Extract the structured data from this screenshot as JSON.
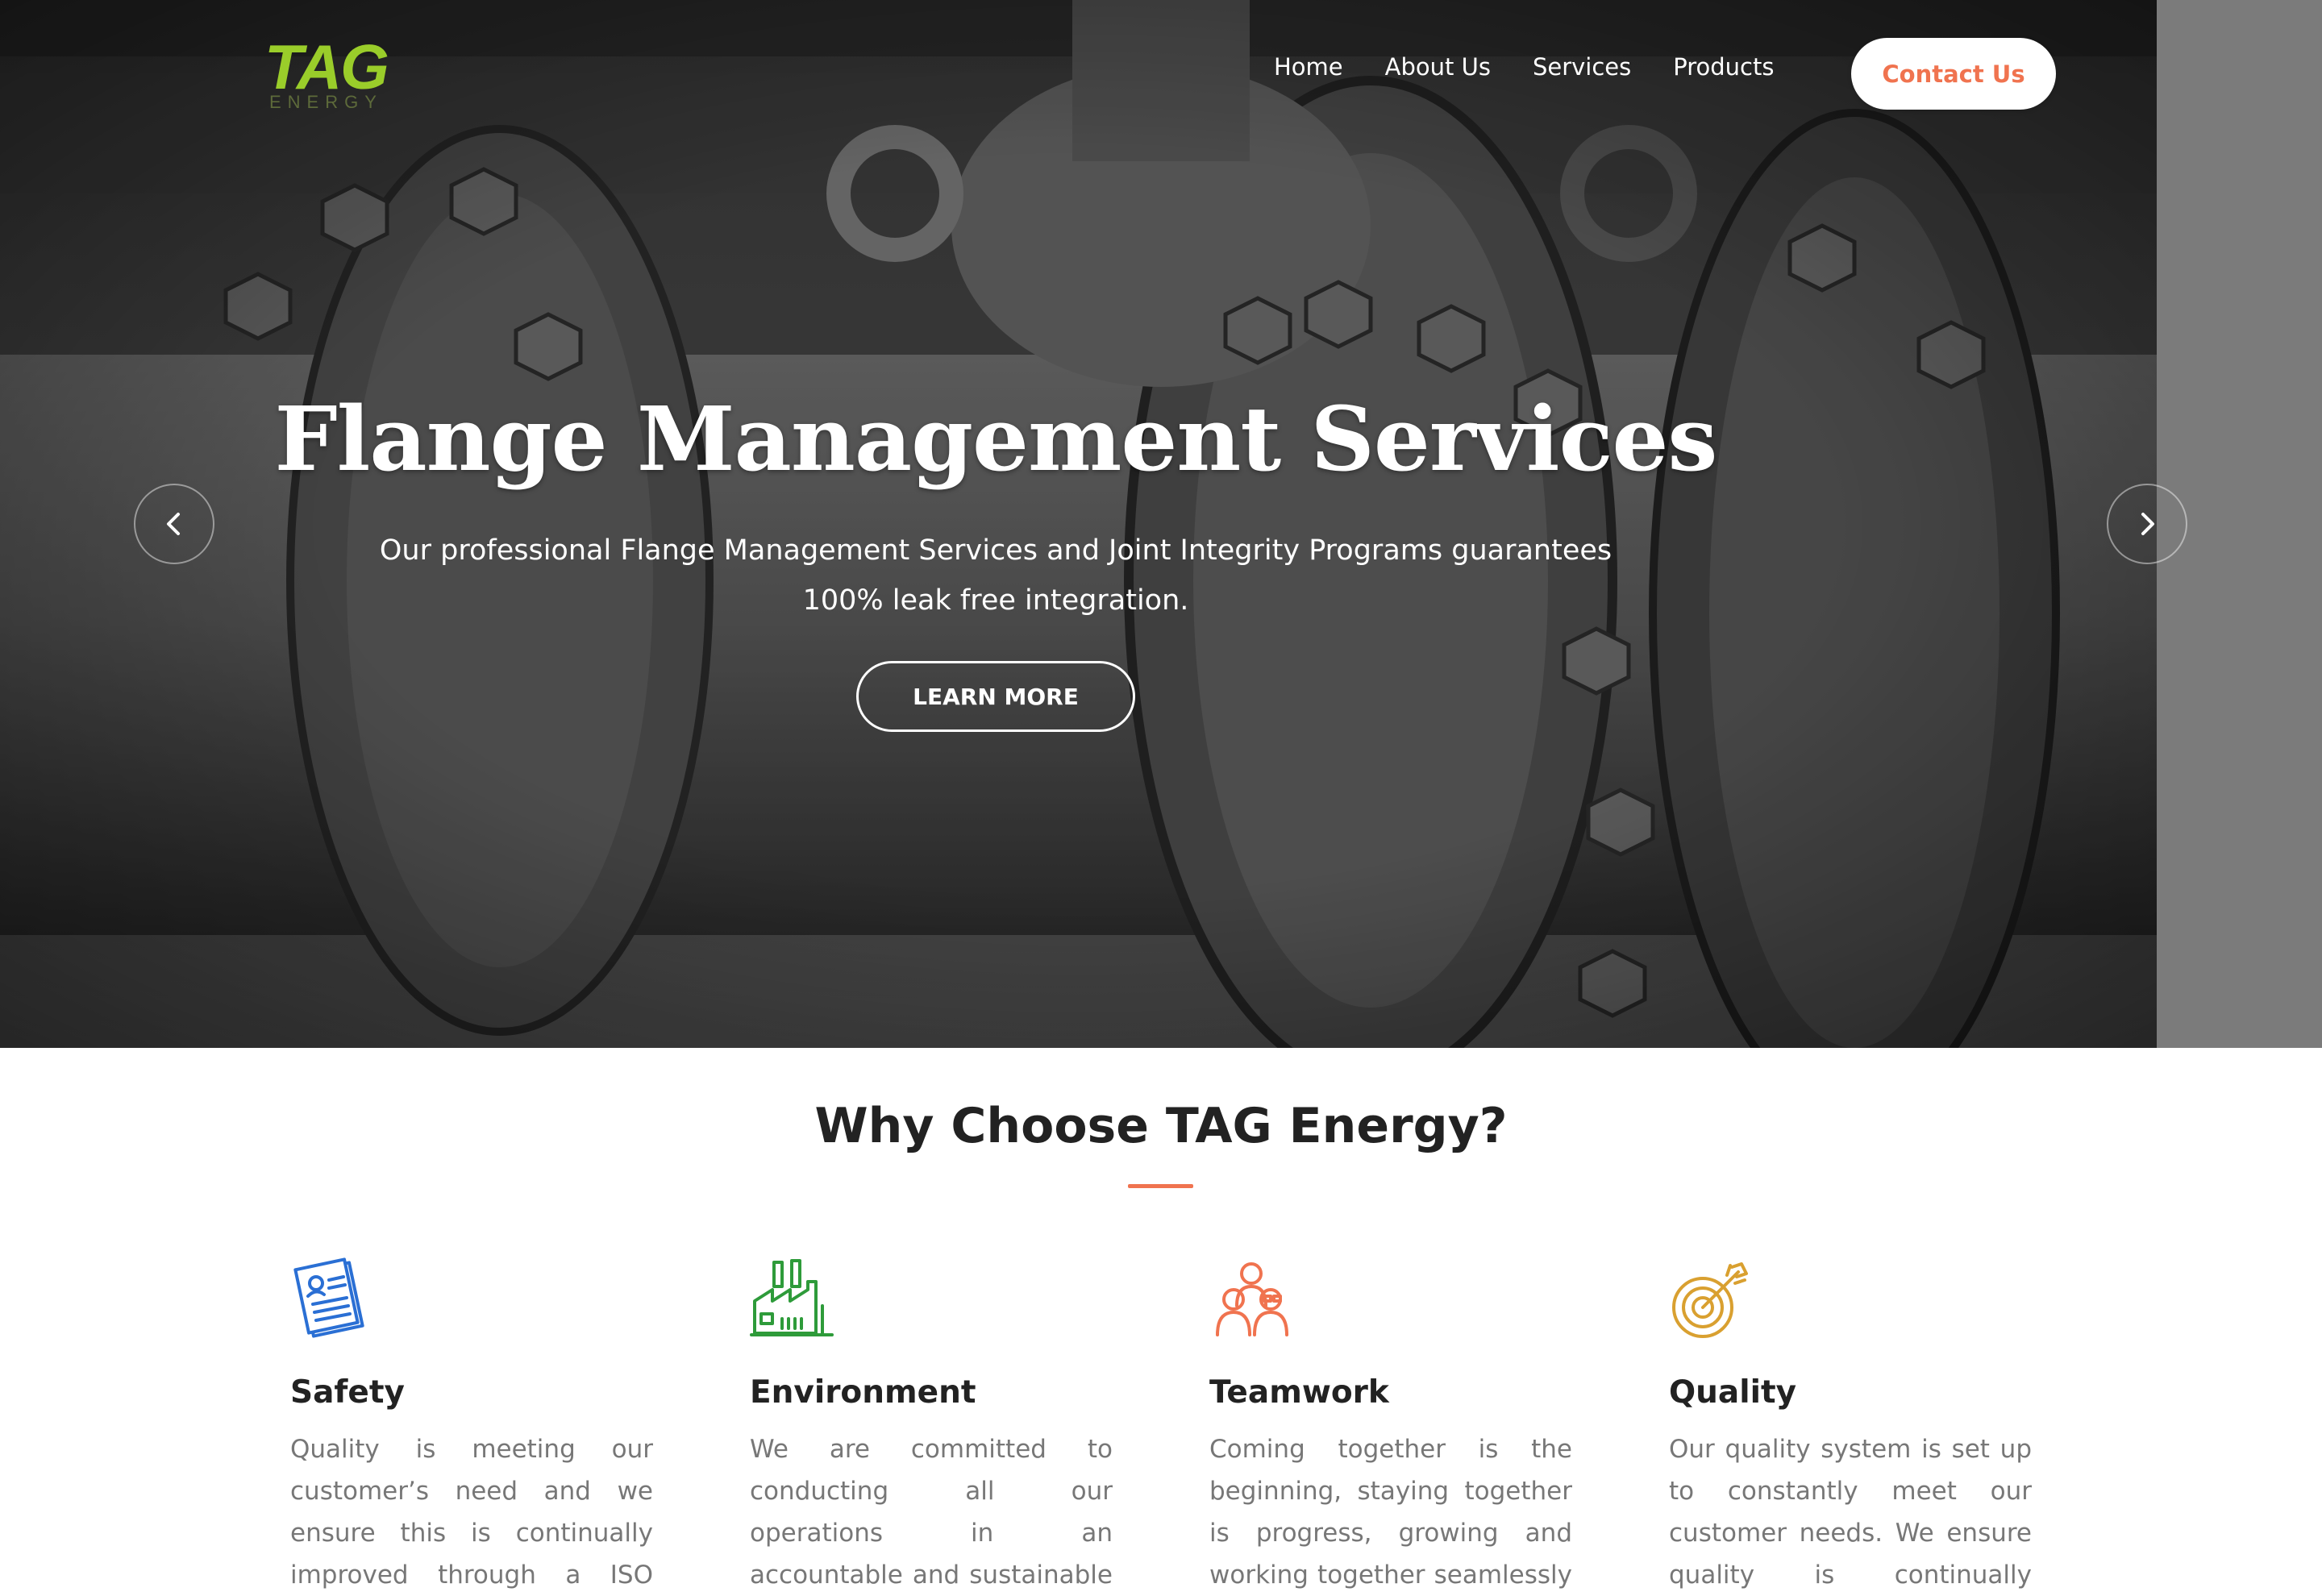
{
  "brand": {
    "logo_main": "TAG",
    "logo_sub": "ENERGY",
    "logo_color": "#9acd2a"
  },
  "nav": {
    "items": [
      {
        "label": "Home"
      },
      {
        "label": "About Us"
      },
      {
        "label": "Services"
      },
      {
        "label": "Products"
      }
    ],
    "contact_label": "Contact Us",
    "accent_color": "#f0734f"
  },
  "hero": {
    "title": "Flange Management Services",
    "text": "Our professional Flange Management Services and Joint Integrity Programs guarantees 100% leak free integration.",
    "button_label": "LEARN MORE",
    "prev_icon": "chevron-left-icon",
    "next_icon": "chevron-right-icon"
  },
  "why": {
    "title": "Why Choose TAG Energy?",
    "features": [
      {
        "title": "Safety",
        "icon": "document-icon",
        "icon_color": "#2a6fd4",
        "text": "Quality is meeting our customer’s need and we ensure this is continually improved through a ISO"
      },
      {
        "title": "Environment",
        "icon": "factory-icon",
        "icon_color": "#2e9b3a",
        "text": "We are committed to conducting all our operations in an accountable and sustainable manner, mindful"
      },
      {
        "title": "Teamwork",
        "icon": "team-icon",
        "icon_color": "#f0734f",
        "text": "Coming together is the beginning, staying together is progress, growing and working together seamlessly"
      },
      {
        "title": "Quality",
        "icon": "target-icon",
        "icon_color": "#d9a030",
        "text": "Our quality system is set up to constantly meet our customer needs. We ensure quality is continually"
      }
    ]
  }
}
